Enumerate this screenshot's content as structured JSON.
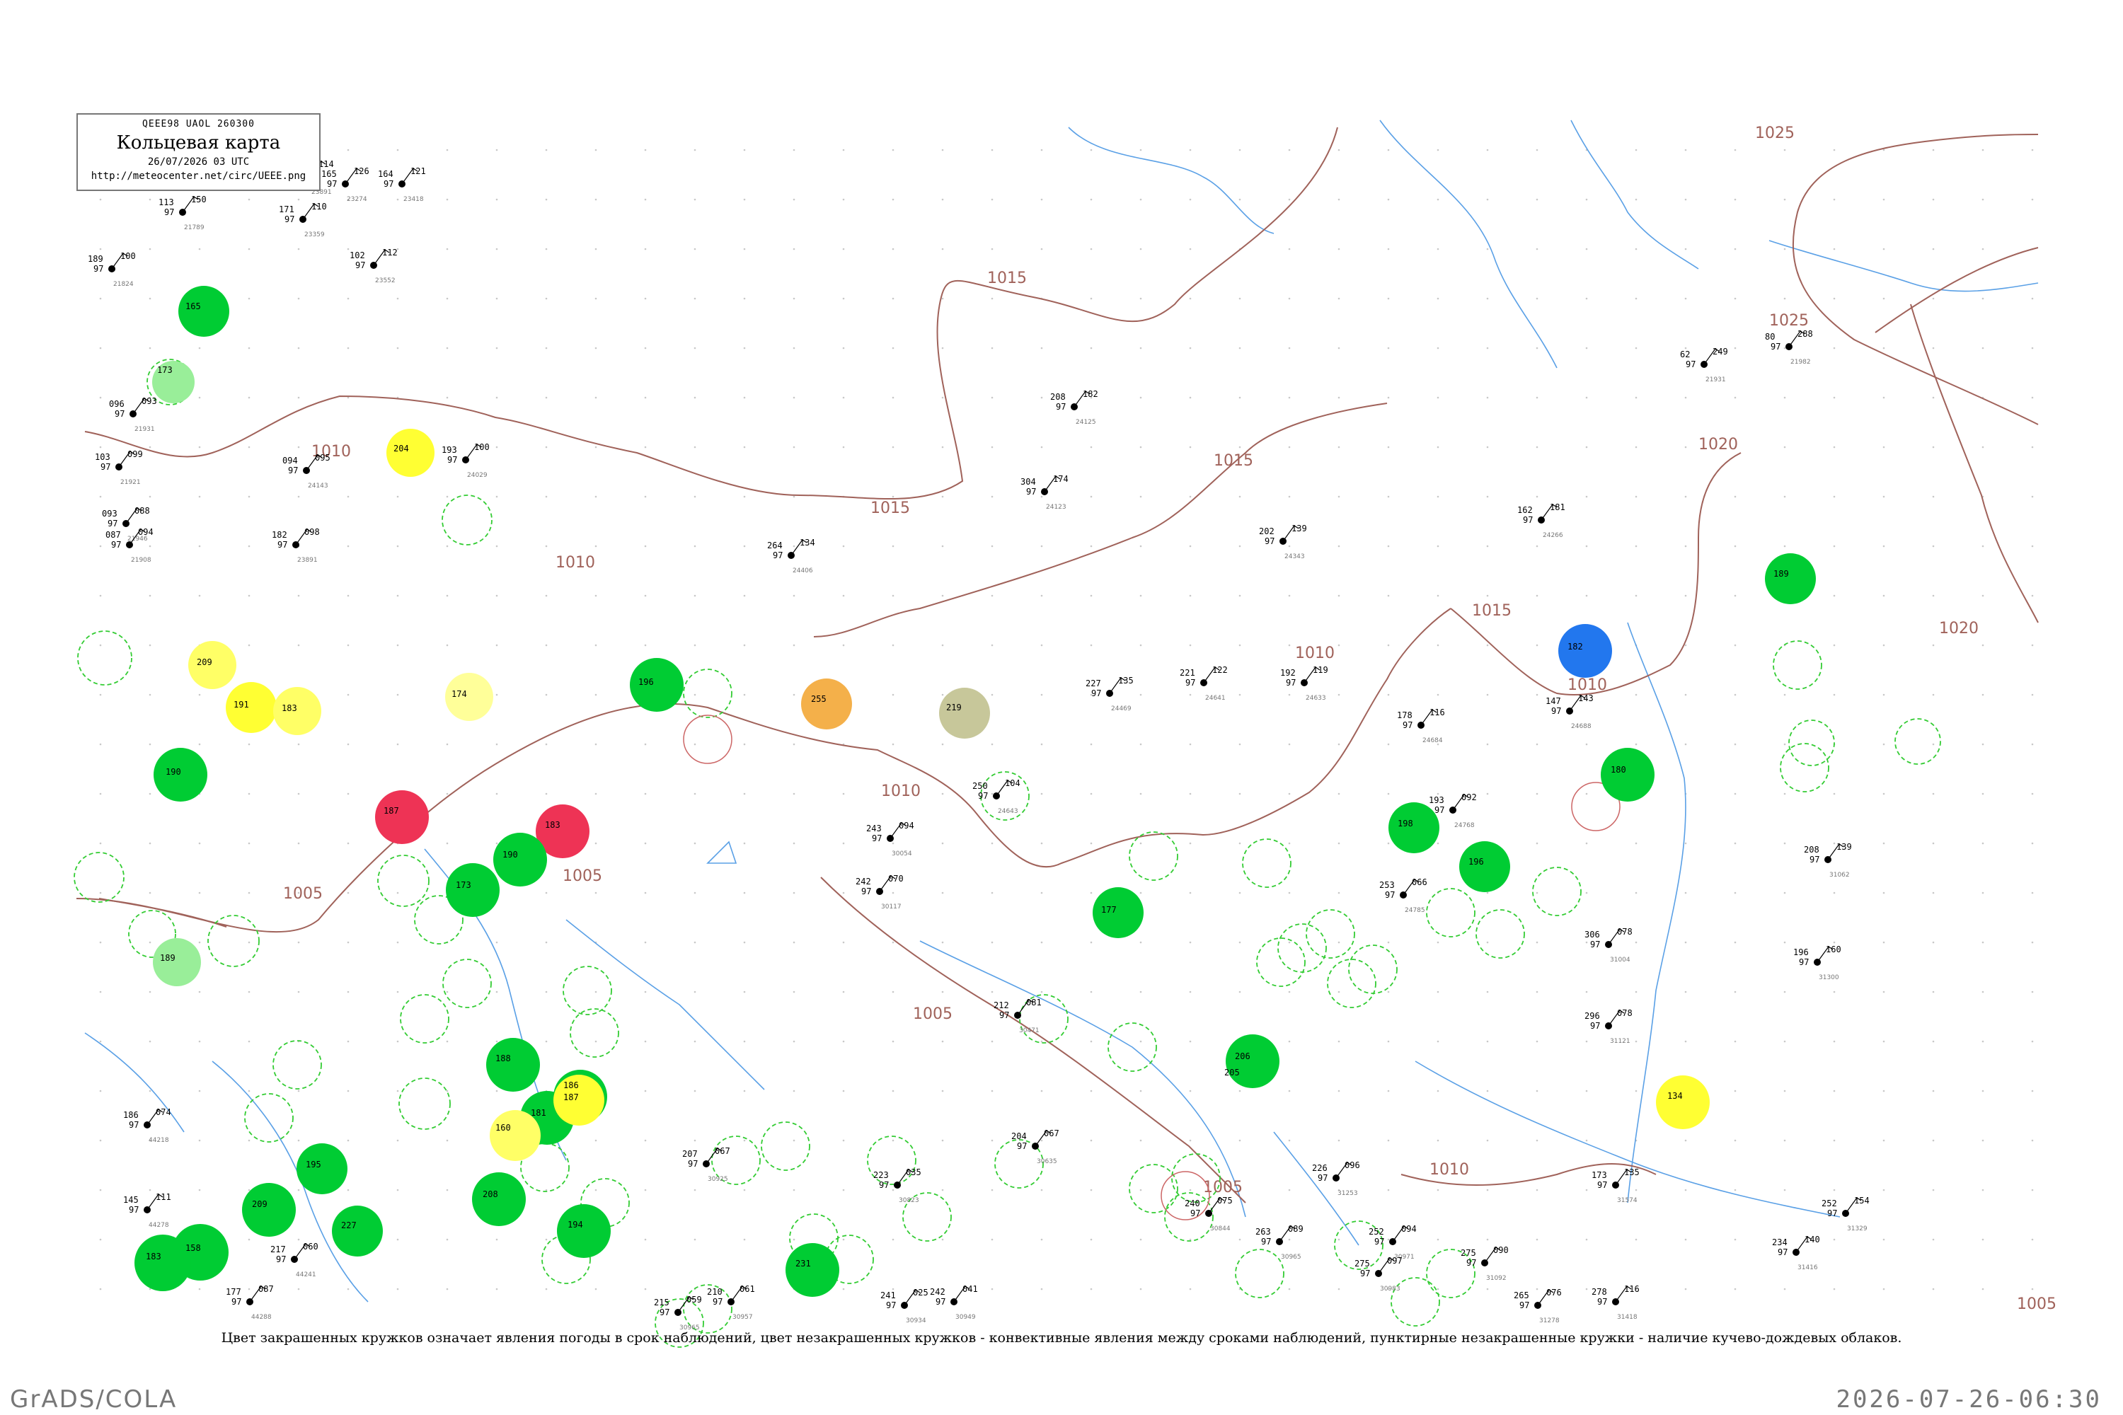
{
  "header": {
    "codes": "QEEE98  UAOL  260300",
    "title": "Кольцевая карта",
    "datetime": "26/07/2026 03 UTC",
    "url": "http://meteocenter.net/circ/UEEE.png"
  },
  "legend": "Цвет закрашенных кружков означает явления погоды в срок наблюдений, цвет незакрашенных кружков - конвективные явления между сроками наблюдений, пунктирные незакрашенные кружки - наличие кучево-дождевых облаков.",
  "footer": {
    "left": "GrADS/COLA",
    "right": "2026-07-26-06:30"
  },
  "colors": {
    "isobar": "#a0625a",
    "river": "#5aa0e6",
    "cb_circle": "#33cc33",
    "border": "#777777"
  },
  "isobars": [
    "1005",
    "1010",
    "1015",
    "1020",
    "1025"
  ],
  "stations": [
    {
      "x": "150",
      "p": "97",
      "t": "113",
      "n": "21789"
    },
    {
      "x": "100",
      "p": "97",
      "t": "189",
      "n": "21824"
    },
    {
      "x": "093",
      "p": "97",
      "t": "096",
      "n": "21931"
    },
    {
      "x": "099",
      "p": "97",
      "t": "103",
      "n": "21921"
    },
    {
      "x": "088",
      "p": "97",
      "t": "093",
      "n": "21946"
    },
    {
      "x": "094",
      "p": "97",
      "t": "087",
      "n": "21908"
    },
    {
      "x": "095",
      "p": "97",
      "t": "094",
      "n": "24143"
    },
    {
      "x": "112",
      "p": "97",
      "t": "102",
      "n": "23552"
    },
    {
      "x": "121",
      "p": "97",
      "t": "164",
      "n": "23418"
    },
    {
      "x": "126",
      "p": "97",
      "t": "165",
      "n": "23274"
    },
    {
      "x": "110",
      "p": "97",
      "t": "171",
      "n": "23359"
    },
    {
      "x": "100",
      "p": "97",
      "t": "193",
      "n": "24029"
    },
    {
      "x": "098",
      "p": "97",
      "t": "182",
      "n": "23891"
    },
    {
      "x": "114",
      "p": "97",
      "t": "105",
      "n": "23891"
    },
    {
      "x": "182",
      "p": "97",
      "t": "208",
      "n": "24125"
    },
    {
      "x": "134",
      "p": "97",
      "t": "264",
      "n": "24406"
    },
    {
      "x": "174",
      "p": "97",
      "t": "304",
      "n": "24123"
    },
    {
      "x": "139",
      "p": "97",
      "t": "202",
      "n": "24343"
    },
    {
      "x": "122",
      "p": "97",
      "t": "221",
      "n": "24641"
    },
    {
      "x": "119",
      "p": "97",
      "t": "192",
      "n": "24633"
    },
    {
      "x": "116",
      "p": "97",
      "t": "178",
      "n": "24684"
    },
    {
      "x": "249",
      "p": "97",
      "t": "62",
      "n": "21931"
    },
    {
      "x": "288",
      "p": "97",
      "t": "80",
      "n": "21982"
    },
    {
      "x": "181",
      "p": "97",
      "t": "162",
      "n": "24266"
    },
    {
      "x": "143",
      "p": "97",
      "t": "147",
      "n": "24688"
    },
    {
      "x": "135",
      "p": "97",
      "t": "227",
      "n": "24469"
    },
    {
      "x": "104",
      "p": "97",
      "t": "250",
      "n": "24643"
    },
    {
      "x": "094",
      "p": "97",
      "t": "243",
      "n": "30054"
    },
    {
      "x": "070",
      "p": "97",
      "t": "242",
      "n": "30117"
    },
    {
      "x": "092",
      "p": "97",
      "t": "193",
      "n": "24768"
    },
    {
      "x": "066",
      "p": "97",
      "t": "253",
      "n": "24785"
    },
    {
      "x": "078",
      "p": "97",
      "t": "306",
      "n": "31004"
    },
    {
      "x": "139",
      "p": "97",
      "t": "208",
      "n": "31062"
    },
    {
      "x": "160",
      "p": "97",
      "t": "196",
      "n": "31300"
    },
    {
      "x": "078",
      "p": "97",
      "t": "296",
      "n": "31121"
    },
    {
      "x": "096",
      "p": "97",
      "t": "226",
      "n": "31253"
    },
    {
      "x": "135",
      "p": "97",
      "t": "173",
      "n": "31574"
    },
    {
      "x": "154",
      "p": "97",
      "t": "252",
      "n": "31329"
    },
    {
      "x": "140",
      "p": "97",
      "t": "234",
      "n": "31416"
    },
    {
      "x": "090",
      "p": "97",
      "t": "275",
      "n": "31092"
    },
    {
      "x": "076",
      "p": "97",
      "t": "265",
      "n": "31278"
    },
    {
      "x": "116",
      "p": "97",
      "t": "278",
      "n": "31418"
    },
    {
      "x": "074",
      "p": "97",
      "t": "186",
      "n": "44218"
    },
    {
      "x": "111",
      "p": "97",
      "t": "145",
      "n": "44278"
    },
    {
      "x": "087",
      "p": "97",
      "t": "177",
      "n": "44288"
    },
    {
      "x": "060",
      "p": "97",
      "t": "217",
      "n": "44241"
    },
    {
      "x": "067",
      "p": "97",
      "t": "207",
      "n": "30925"
    },
    {
      "x": "059",
      "p": "97",
      "t": "215",
      "n": "30965"
    },
    {
      "x": "061",
      "p": "97",
      "t": "210",
      "n": "30957"
    },
    {
      "x": "025",
      "p": "97",
      "t": "241",
      "n": "30934"
    },
    {
      "x": "041",
      "p": "97",
      "t": "242",
      "n": "30949"
    },
    {
      "x": "081",
      "p": "97",
      "t": "212",
      "n": "30471"
    },
    {
      "x": "067",
      "p": "97",
      "t": "204",
      "n": "30635"
    },
    {
      "x": "035",
      "p": "97",
      "t": "223",
      "n": "30823"
    },
    {
      "x": "075",
      "p": "97",
      "t": "240",
      "n": "30844"
    },
    {
      "x": "089",
      "p": "97",
      "t": "263",
      "n": "30965"
    },
    {
      "x": "094",
      "p": "97",
      "t": "252",
      "n": "30971"
    },
    {
      "x": "097",
      "p": "97",
      "t": "275",
      "n": "30983"
    }
  ],
  "filled_markers": [
    {
      "color": "#00cc33",
      "label": "165"
    },
    {
      "color": "#99ee99",
      "label": "173"
    },
    {
      "color": "#ffff33",
      "label": "204"
    },
    {
      "color": "#ffff66",
      "label": "209"
    },
    {
      "color": "#ffff33",
      "label": "191"
    },
    {
      "color": "#ffff66",
      "label": "183"
    },
    {
      "color": "#ffff99",
      "label": "174"
    },
    {
      "color": "#00cc33",
      "label": "190"
    },
    {
      "color": "#ee3355",
      "label": "187"
    },
    {
      "color": "#ee3355",
      "label": "183"
    },
    {
      "color": "#00cc33",
      "label": "190"
    },
    {
      "color": "#00cc33",
      "label": "196"
    },
    {
      "color": "#f4b04a",
      "label": "255"
    },
    {
      "color": "#c7c79a",
      "label": "219"
    },
    {
      "color": "#00cc33",
      "label": "177"
    },
    {
      "color": "#00cc33",
      "label": "206"
    },
    {
      "color": "#2277ee",
      "label": "182"
    },
    {
      "color": "#00cc33",
      "label": "180"
    },
    {
      "color": "#00cc33",
      "label": "198"
    },
    {
      "color": "#00cc33",
      "label": "196"
    },
    {
      "color": "#00cc33",
      "label": "189"
    },
    {
      "color": "#ffff33",
      "label": "134"
    },
    {
      "color": "#00cc33",
      "label": "173"
    },
    {
      "color": "#00cc33",
      "label": "188"
    },
    {
      "color": "#00cc33",
      "label": "181"
    },
    {
      "color": "#ffff66",
      "label": "160"
    },
    {
      "color": "#00cc33",
      "label": "186"
    },
    {
      "color": "#ffff33",
      "label": "187"
    },
    {
      "color": "#00cc33",
      "label": "195"
    },
    {
      "color": "#00cc33",
      "label": "209"
    },
    {
      "color": "#00cc33",
      "label": "227"
    },
    {
      "color": "#00cc33",
      "label": "158"
    },
    {
      "color": "#00cc33",
      "label": "183"
    },
    {
      "color": "#00cc33",
      "label": "208"
    },
    {
      "color": "#00cc33",
      "label": "231"
    },
    {
      "color": "#00cc33",
      "label": "194"
    },
    {
      "color": "#99ee99",
      "label": "189"
    },
    {
      "color": "#00cc33",
      "label": "205"
    }
  ]
}
